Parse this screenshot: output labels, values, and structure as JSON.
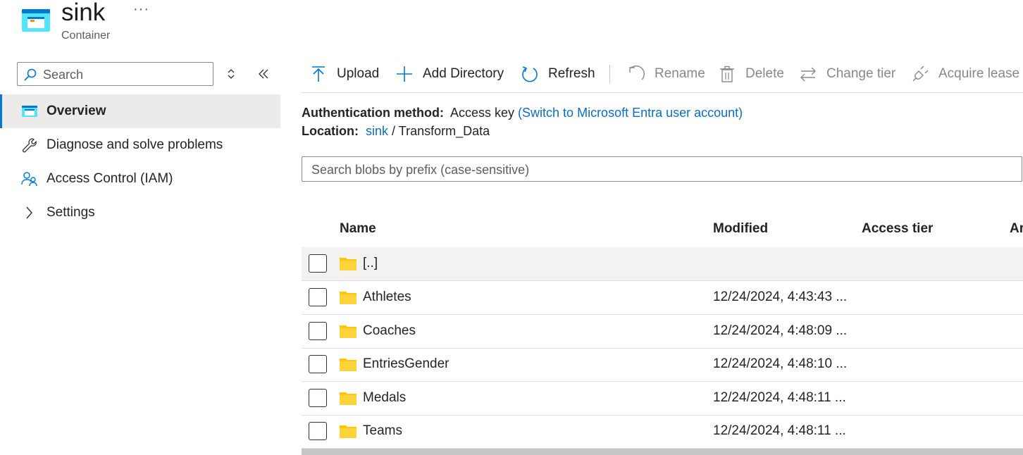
{
  "header": {
    "title": "sink",
    "more": "···",
    "subtitle": "Container"
  },
  "sidebar": {
    "search_placeholder": "Search",
    "items": [
      {
        "label": "Overview",
        "icon": "container-icon",
        "active": true
      },
      {
        "label": "Diagnose and solve problems",
        "icon": "wrench-icon"
      },
      {
        "label": "Access Control (IAM)",
        "icon": "people-icon"
      },
      {
        "label": "Settings",
        "icon": "chevron-right-icon"
      }
    ]
  },
  "toolbar": {
    "upload": "Upload",
    "add_directory": "Add Directory",
    "refresh": "Refresh",
    "rename": "Rename",
    "delete": "Delete",
    "change_tier": "Change tier",
    "acquire_lease": "Acquire lease"
  },
  "info": {
    "auth_label": "Authentication method:",
    "auth_value": "Access key",
    "auth_link": "(Switch to Microsoft Entra user account)",
    "location_label": "Location:",
    "location_link": "sink",
    "location_sep": "/",
    "location_path": "Transform_Data"
  },
  "blob_search": {
    "placeholder": "Search blobs by prefix (case-sensitive)"
  },
  "table": {
    "headers": {
      "name": "Name",
      "modified": "Modified",
      "access_tier": "Access tier",
      "archive": "Ar"
    },
    "rows": [
      {
        "name": "[..]",
        "modified": ""
      },
      {
        "name": "Athletes",
        "modified": "12/24/2024, 4:43:43 ..."
      },
      {
        "name": "Coaches",
        "modified": "12/24/2024, 4:48:09 ..."
      },
      {
        "name": "EntriesGender",
        "modified": "12/24/2024, 4:48:10 ..."
      },
      {
        "name": "Medals",
        "modified": "12/24/2024, 4:48:11 ..."
      },
      {
        "name": "Teams",
        "modified": "12/24/2024, 4:48:11 ..."
      }
    ]
  },
  "colors": {
    "accent": "#0078d4",
    "link": "#0f6cbd",
    "folder": "#ffc700",
    "disabled": "#8a8886"
  }
}
